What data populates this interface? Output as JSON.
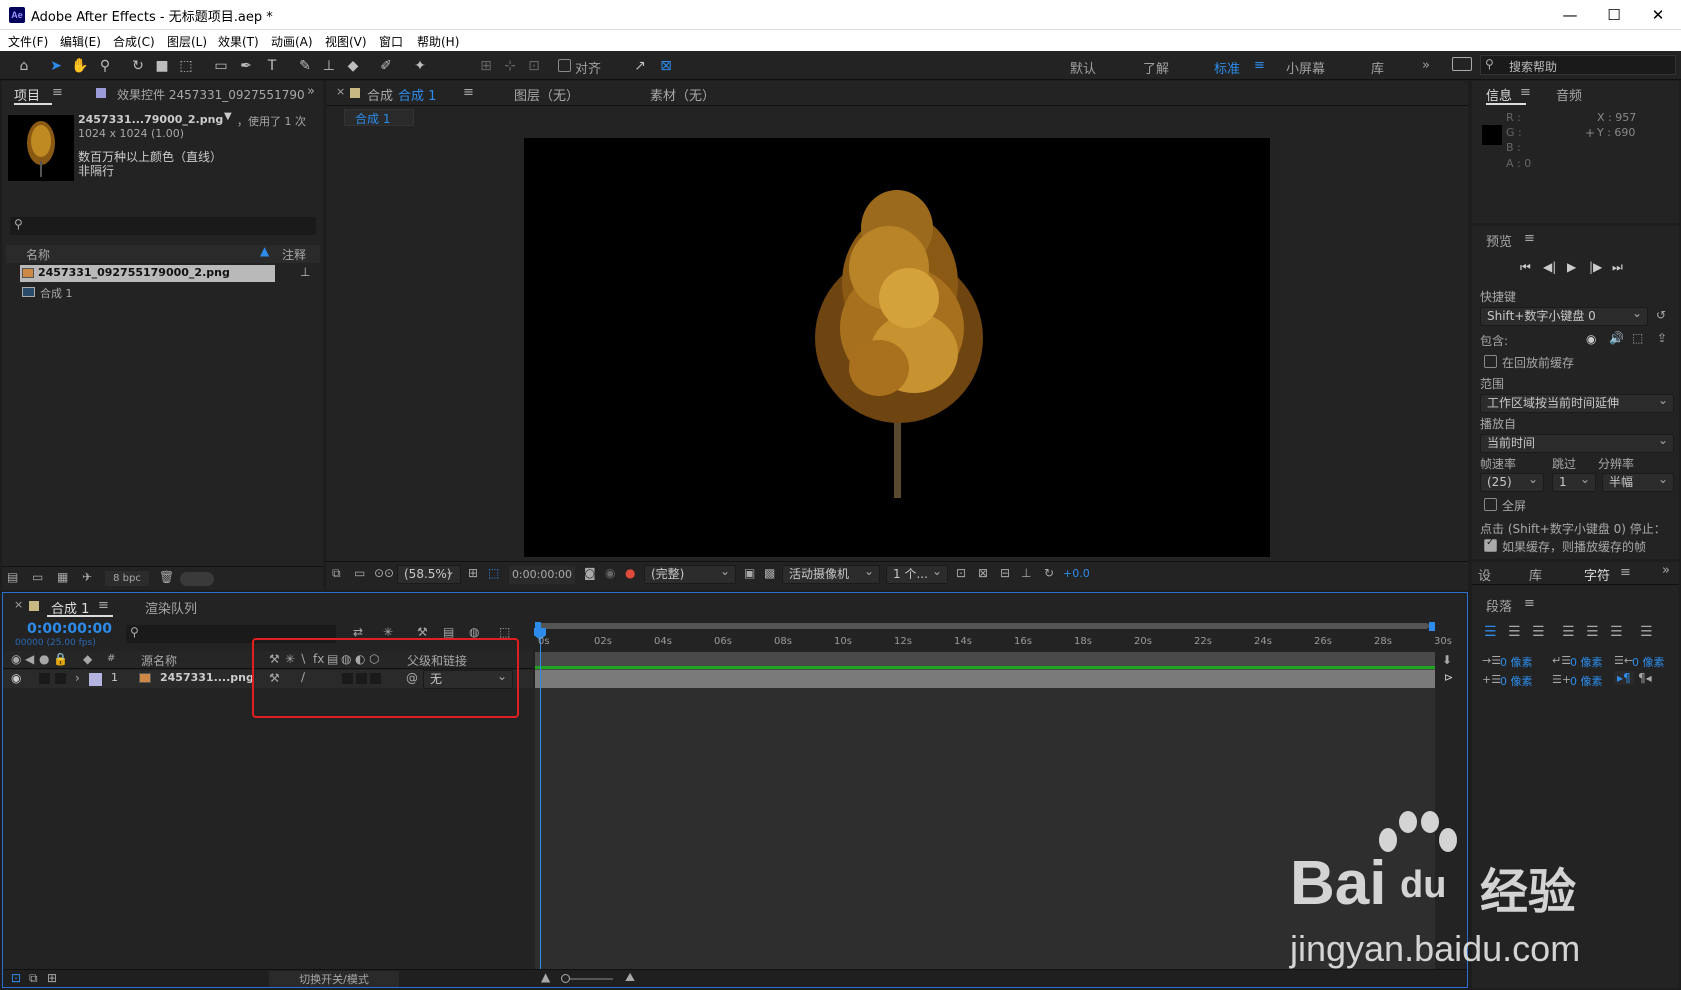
{
  "app": {
    "title": "Adobe After Effects - 无标题项目.aep *",
    "logo": "Ae"
  },
  "window_controls": {
    "minimize": "—",
    "maximize": "☐",
    "close": "✕"
  },
  "menu": [
    "文件(F)",
    "编辑(E)",
    "合成(C)",
    "图层(L)",
    "效果(T)",
    "动画(A)",
    "视图(V)",
    "窗口",
    "帮助(H)"
  ],
  "toolbar": {
    "tools": [
      "home-icon",
      "selection-tool-icon",
      "hand-tool-icon",
      "zoom-tool-icon",
      "rotate-tool-icon",
      "camera-tool-icon",
      "pan-behind-tool-icon",
      "rectangle-tool-icon",
      "pen-tool-icon",
      "type-tool-icon",
      "brush-tool-icon",
      "clone-stamp-icon",
      "eraser-icon",
      "roto-brush-icon",
      "puppet-pin-icon"
    ],
    "align_label": "对齐",
    "workspaces": [
      "默认",
      "了解",
      "标准",
      "小屏幕",
      "库"
    ],
    "active_workspace": "标准",
    "search_placeholder": "搜索帮助"
  },
  "project": {
    "tab_project": "项目",
    "tab_effects": "效果控件 2457331_0927551790",
    "file_name": "2457331...79000_2.png",
    "usage": "，使用了 1 次",
    "dimensions": "1024 x 1024 (1.00)",
    "color_info": "数百万种以上颜色（直线）",
    "interlace": "非隔行",
    "col_name": "名称",
    "col_comment": "注释",
    "items": [
      {
        "name": "2457331_092755179000_2.png",
        "type": "image",
        "selected": true
      },
      {
        "name": "合成 1",
        "type": "composition",
        "selected": false
      }
    ],
    "bpc": "8 bpc"
  },
  "viewer": {
    "tab_comp": "合成",
    "comp_name": "合成 1",
    "tab_layer": "图层（无）",
    "tab_footage": "素材（无）",
    "subtab": "合成 1",
    "zoom": "(58.5%)",
    "timecode": "0:00:00:00",
    "resolution": "(完整)",
    "camera": "活动摄像机",
    "views": "1 个...",
    "exposure": "+0.0"
  },
  "info": {
    "tab_info": "信息",
    "tab_audio": "音频",
    "r": "R :",
    "g": "G :",
    "b": "B :",
    "a": "A : 0",
    "x": "X : 957",
    "y": "Y : 690"
  },
  "preview": {
    "title": "预览",
    "shortcut_label": "快捷键",
    "shortcut_value": "Shift+数字小键盘 0",
    "include_label": "包含:",
    "cache_label": "在回放前缓存",
    "range_label": "范围",
    "range_value": "工作区域按当前时间延伸",
    "play_from_label": "播放自",
    "play_from_value": "当前时间",
    "framerate_label": "帧速率",
    "skip_label": "跳过",
    "resolution_label": "分辨率",
    "framerate_value": "(25)",
    "skip_value": "1",
    "resolution_value": "半幅",
    "fullscreen_label": "全屏",
    "click_stop_label": "点击 (Shift+数字小键盘 0) 停止：",
    "cache_frames_label": "如果缓存，则播放缓存的帧"
  },
  "right_tabs": {
    "t1": "设",
    "t2": "库",
    "t3": "字符"
  },
  "paragraph": {
    "title": "段落",
    "px1": "0 像素",
    "px2": "0 像素",
    "px3": "0 像素",
    "px4": "0 像素",
    "px5": "0 像素"
  },
  "timeline": {
    "tab_comp": "合成 1",
    "tab_render": "渲染队列",
    "timecode": "0:00:00:00",
    "frame_info": "00000 (25.00 fps)",
    "col_source": "源名称",
    "col_parent": "父级和链接",
    "col_num": "#",
    "layer_num": "1",
    "layer_name": "2457331....png",
    "parent_value": "无",
    "ticks": [
      "0s",
      "02s",
      "04s",
      "06s",
      "08s",
      "10s",
      "12s",
      "14s",
      "16s",
      "18s",
      "20s",
      "22s",
      "24s",
      "26s",
      "28s",
      "30s"
    ],
    "toggle_label": "切换开关/模式"
  },
  "watermark": {
    "brand_a": "Bai",
    "brand_b": "du",
    "brand_c": "经验",
    "url": "jingyan.baidu.com"
  },
  "colors": {
    "accent": "#2d8ceb",
    "highlight_box": "#e02020",
    "work_area": "#1fa51f"
  }
}
